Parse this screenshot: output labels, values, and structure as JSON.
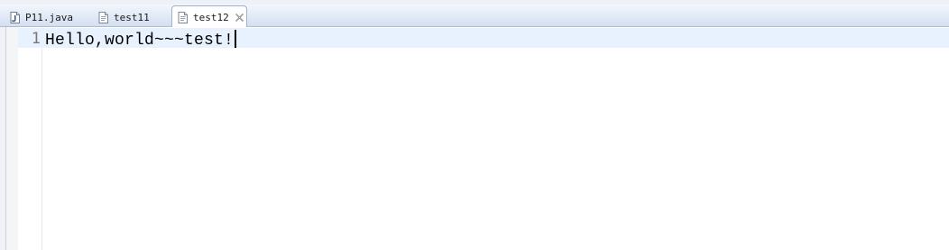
{
  "tabs": [
    {
      "label": "P11.java",
      "icon": "java-file-icon"
    },
    {
      "label": "test11",
      "icon": "text-file-icon"
    },
    {
      "label": "test12",
      "icon": "text-file-icon",
      "active": true
    }
  ],
  "editor": {
    "lines": [
      {
        "number": "1",
        "text": "Hello,world~~~test!"
      }
    ],
    "current_line_color": "#e8f2fe"
  },
  "colors": {
    "tabbar_gradient_top": "#f4f7fb",
    "tabbar_gradient_bottom": "#d4dfee",
    "active_tab_border": "#9fb3d1"
  }
}
